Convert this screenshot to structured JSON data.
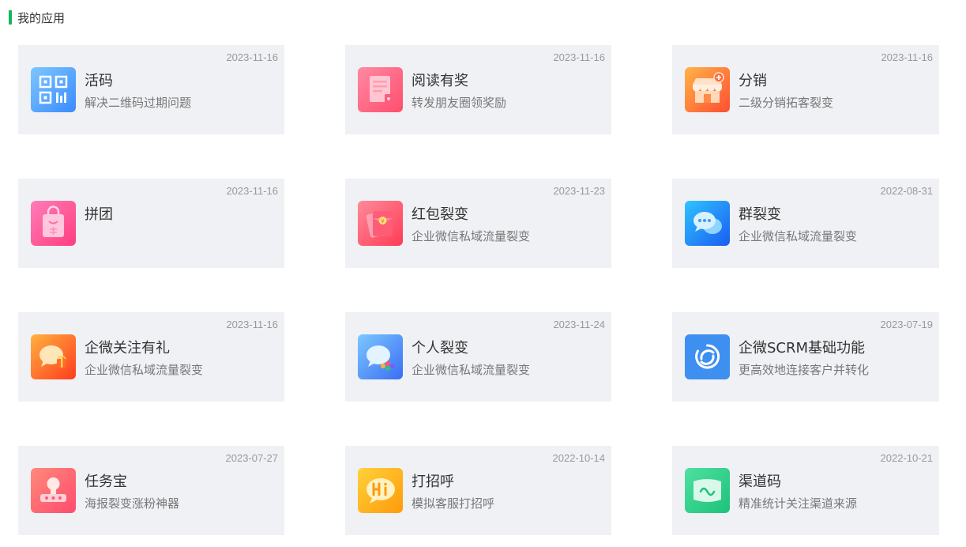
{
  "section": {
    "title": "我的应用",
    "accent_color": "#19b55c"
  },
  "apps": [
    {
      "id": "live-code",
      "name": "活码",
      "desc": "解决二维码过期问题",
      "date": "2023-11-16",
      "icon": "qr-code-icon"
    },
    {
      "id": "reading-reward",
      "name": "阅读有奖",
      "desc": "转发朋友圈领奖励",
      "date": "2023-11-16",
      "icon": "document-reward-icon"
    },
    {
      "id": "distribution",
      "name": "分销",
      "desc": "二级分销拓客裂变",
      "date": "2023-11-16",
      "icon": "storefront-icon"
    },
    {
      "id": "group-buy",
      "name": "拼团",
      "desc": "",
      "date": "2023-11-16",
      "icon": "shopping-bag-icon"
    },
    {
      "id": "red-packet-fission",
      "name": "红包裂变",
      "desc": "企业微信私域流量裂变",
      "date": "2023-11-23",
      "icon": "red-packet-icon"
    },
    {
      "id": "group-fission",
      "name": "群裂变",
      "desc": "企业微信私域流量裂变",
      "date": "2022-08-31",
      "icon": "chat-bubbles-icon"
    },
    {
      "id": "follow-gift",
      "name": "企微关注有礼",
      "desc": "企业微信私域流量裂变",
      "date": "2023-11-16",
      "icon": "chat-gift-icon"
    },
    {
      "id": "personal-fission",
      "name": "个人裂变",
      "desc": "企业微信私域流量裂变",
      "date": "2023-11-24",
      "icon": "chat-share-icon"
    },
    {
      "id": "scrm-basic",
      "name": "企微SCRM基础功能",
      "desc": "更高效地连接客户并转化",
      "date": "2023-07-19",
      "icon": "scrm-logo-icon"
    },
    {
      "id": "task-treasure",
      "name": "任务宝",
      "desc": "海报裂变涨粉神器",
      "date": "2023-07-27",
      "icon": "mascot-icon"
    },
    {
      "id": "greeting",
      "name": "打招呼",
      "desc": "模拟客服打招呼",
      "date": "2022-10-14",
      "icon": "hi-bubble-icon"
    },
    {
      "id": "channel-code",
      "name": "渠道码",
      "desc": "精准统计关注渠道来源",
      "date": "2022-10-21",
      "icon": "channel-map-icon"
    }
  ]
}
